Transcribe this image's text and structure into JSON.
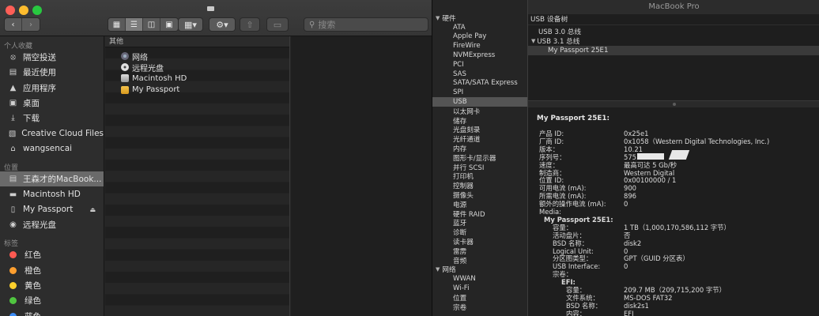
{
  "finder": {
    "search_placeholder": "搜索",
    "sidebar": {
      "sections": [
        {
          "title": "个人收藏",
          "items": [
            {
              "label": "隔空投送",
              "icon": "airdrop-icon"
            },
            {
              "label": "最近使用",
              "icon": "recents-icon"
            },
            {
              "label": "应用程序",
              "icon": "applications-icon"
            },
            {
              "label": "桌面",
              "icon": "desktop-icon"
            },
            {
              "label": "下载",
              "icon": "downloads-icon"
            },
            {
              "label": "Creative Cloud Files",
              "icon": "folder-icon"
            },
            {
              "label": "wangsencai",
              "icon": "home-icon"
            }
          ]
        },
        {
          "title": "位置",
          "items": [
            {
              "label": "王森才的MacBook...",
              "icon": "laptop-icon",
              "selected": true
            },
            {
              "label": "Macintosh HD",
              "icon": "drive-icon"
            },
            {
              "label": "My Passport",
              "icon": "external-drive-icon",
              "eject": true
            },
            {
              "label": "远程光盘",
              "icon": "disc-icon"
            }
          ]
        },
        {
          "title": "标签",
          "items": [
            {
              "label": "红色",
              "color": "#ff5a52"
            },
            {
              "label": "橙色",
              "color": "#ff9f2f"
            },
            {
              "label": "黄色",
              "color": "#ffd02c"
            },
            {
              "label": "绿色",
              "color": "#50c540"
            },
            {
              "label": "蓝色",
              "color": "#3c8cf6"
            }
          ]
        }
      ]
    },
    "column1": {
      "header": "其他",
      "items": [
        {
          "label": "网络",
          "icon": "network-icon"
        },
        {
          "label": "远程光盘",
          "icon": "disc-icon"
        },
        {
          "label": "Macintosh HD",
          "icon": "drive-icon"
        },
        {
          "label": "My Passport",
          "icon": "external-drive-icon"
        }
      ]
    }
  },
  "sysinfo": {
    "window_title": "MacBook Pro",
    "tree": [
      {
        "group": "硬件",
        "items": [
          "ATA",
          "Apple Pay",
          "FireWire",
          "NVMExpress",
          "PCI",
          "SAS",
          "SATA/SATA Express",
          "SPI",
          "USB",
          "以太网卡",
          "储存",
          "光盘刻录",
          "光纤通道",
          "内存",
          "图形卡/显示器",
          "并行 SCSI",
          "打印机",
          "控制器",
          "摄像头",
          "电源",
          "硬件 RAID",
          "蓝牙",
          "诊断",
          "读卡器",
          "雷雳",
          "音频"
        ]
      },
      {
        "group": "网络",
        "items": [
          "WWAN",
          "Wi-Fi",
          "位置",
          "宗卷"
        ]
      }
    ],
    "selected_item": "USB",
    "usb_tree": {
      "header": "USB 设备树",
      "rows": [
        {
          "label": "USB 3.0 总线",
          "level": 0
        },
        {
          "label": "USB 3.1 总线",
          "level": 0,
          "expanded": true
        },
        {
          "label": "My Passport 25E1",
          "level": 1,
          "selected": true
        }
      ]
    },
    "detail": {
      "title": "My Passport 25E1:",
      "rows": [
        {
          "label": "产品 ID:",
          "value": "0x25e1",
          "level": 0
        },
        {
          "label": "厂商 ID:",
          "value": "0x1058（Western Digital Technologies, Inc.)",
          "level": 0
        },
        {
          "label": "版本：",
          "value": "10.21",
          "level": 0
        },
        {
          "label": "序列号：",
          "value": "575...4B43",
          "level": 0
        },
        {
          "label": "速度：",
          "value": "最高可达 5 Gb/秒",
          "level": 0
        },
        {
          "label": "制造商：",
          "value": "Western Digital",
          "level": 0
        },
        {
          "label": "位置 ID:",
          "value": "0x00100000 / 1",
          "level": 0
        },
        {
          "label": "可用电流 (mA):",
          "value": "900",
          "level": 0
        },
        {
          "label": "所需电流 (mA):",
          "value": "896",
          "level": 0
        },
        {
          "label": "额外的操作电流 (mA):",
          "value": "0",
          "level": 0
        },
        {
          "label": "Media:",
          "value": "",
          "level": 0
        },
        {
          "label": "My Passport 25E1:",
          "value": "",
          "level": 1,
          "sub": true
        },
        {
          "label": "容量：",
          "value": "1 TB（1,000,170,586,112 字节）",
          "level": 2
        },
        {
          "label": "活动盘片：",
          "value": "否",
          "level": 2
        },
        {
          "label": "BSD 名称：",
          "value": "disk2",
          "level": 2
        },
        {
          "label": "Logical Unit:",
          "value": "0",
          "level": 2
        },
        {
          "label": "分区图类型：",
          "value": "GPT（GUID 分区表）",
          "level": 2
        },
        {
          "label": "USB Interface:",
          "value": "0",
          "level": 2
        },
        {
          "label": "宗卷：",
          "value": "",
          "level": 2
        },
        {
          "label": "EFI:",
          "value": "",
          "level": 3,
          "sub": true
        },
        {
          "label": "容量：",
          "value": "209.7 MB（209,715,200 字节）",
          "level": 4
        },
        {
          "label": "文件系统：",
          "value": "MS-DOS FAT32",
          "level": 4
        },
        {
          "label": "BSD 名称：",
          "value": "disk2s1",
          "level": 4
        },
        {
          "label": "内容：",
          "value": "EFI",
          "level": 4
        }
      ]
    }
  }
}
